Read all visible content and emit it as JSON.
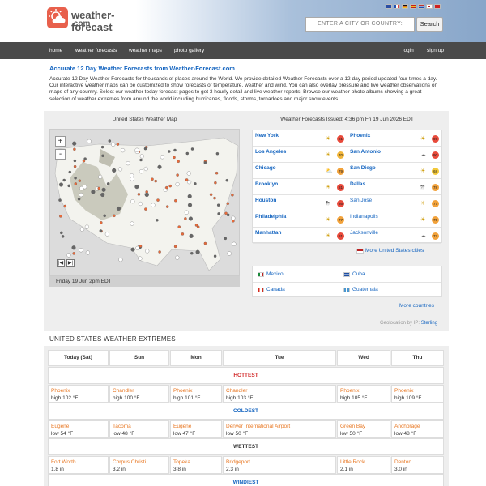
{
  "header": {
    "logo_line1": "weather-forecast",
    "logo_line2": ".com",
    "search_placeholder": "ENTER A CITY OR COUNTRY:",
    "search_button": "Search",
    "flag_colors": [
      "#2b4ea3",
      "#e04040",
      "#e8c020",
      "#c02020",
      "#d03030",
      "#2060c0"
    ]
  },
  "nav": {
    "items": [
      "home",
      "weather forecasts",
      "weather maps",
      "photo gallery"
    ],
    "login": "login",
    "signup": "sign up"
  },
  "intro": {
    "title": "Accurate 12 Day Weather Forecasts from Weather-Forecast.com",
    "text": "Accurate 12 Day Weather Forecasts for thousands of places around the World. We provide detailed Weather Forecasts over a 12 day period updated four times a day. Our interactive weather maps can be customized to show forecasts of temperature, weather and wind. You can also overlay pressure and live weather observations on maps of any country. Select our weather today forecast pages to get 3 hourly detail and live weather reports. Browse our weather photo albums showing a great selection of weather extremes from around the world including hurricanes, floods, storms, tornadoes and major snow events."
  },
  "map": {
    "title": "United States Weather Map",
    "zoom_in": "+",
    "zoom_out": "-",
    "prev": "|◀",
    "next": "▶|",
    "time_label": "Friday 19 Jun 2pm EDT"
  },
  "forecast": {
    "title": "Weather Forecasts Issued: 4:36 pm Fri 19 Jun 2026 EDT",
    "cities": [
      {
        "name": "New York",
        "icon": "☀",
        "temp": "81",
        "color": "#e84a3b",
        "bold": true
      },
      {
        "name": "Phoenix",
        "icon": "☀",
        "temp": "99",
        "color": "#e84a3b",
        "bold": true
      },
      {
        "name": "Los Angeles",
        "icon": "☀",
        "temp": "70",
        "color": "#f2b63a",
        "bold": true
      },
      {
        "name": "San Antonio",
        "icon": "☁",
        "temp": "90",
        "color": "#e84a3b",
        "bold": true
      },
      {
        "name": "Chicago",
        "icon": "⛅",
        "temp": "79",
        "color": "#f2a23a",
        "bold": true
      },
      {
        "name": "San Diego",
        "icon": "☀",
        "temp": "68",
        "color": "#f2c83a",
        "bold": true
      },
      {
        "name": "Brooklyn",
        "icon": "☀",
        "temp": "81",
        "color": "#e84a3b",
        "bold": true
      },
      {
        "name": "Dallas",
        "icon": "⛈",
        "temp": "78",
        "color": "#f2a23a",
        "bold": true
      },
      {
        "name": "Houston",
        "icon": "⛈",
        "temp": "86",
        "color": "#e84a3b",
        "bold": true
      },
      {
        "name": "San Jose",
        "icon": "☀",
        "temp": "77",
        "color": "#f2a23a",
        "bold": false
      },
      {
        "name": "Philadelphia",
        "icon": "☀",
        "temp": "77",
        "color": "#f2a23a",
        "bold": true
      },
      {
        "name": "Indianapolis",
        "icon": "☀",
        "temp": "75",
        "color": "#f2a23a",
        "bold": false
      },
      {
        "name": "Manhattan",
        "icon": "☀",
        "temp": "81",
        "color": "#e84a3b",
        "bold": true
      },
      {
        "name": "Jacksonville",
        "icon": "☁",
        "temp": "77",
        "color": "#f2a23a",
        "bold": false
      }
    ],
    "more_us": "More United States cities"
  },
  "countries": {
    "items": [
      {
        "name": "Mexico",
        "color": "#1a8a3a"
      },
      {
        "name": "Cuba",
        "color": "#1e4fa3"
      },
      {
        "name": "Canada",
        "color": "#d52b1e"
      },
      {
        "name": "Guatemala",
        "color": "#4997d0"
      }
    ],
    "more": "More countries"
  },
  "geo": {
    "label": "Geolocation by IP:",
    "city": "Sterling"
  },
  "extremes": {
    "title": "UNITED STATES WEATHER EXTREMES",
    "days": [
      "Today (Sat)",
      "Sun",
      "Mon",
      "Tue",
      "Wed",
      "Thu"
    ],
    "sections": [
      {
        "label": "HOTTEST",
        "color": "#d32f2f",
        "rows": [
          {
            "city": "Phoenix",
            "value": "high 102 °F"
          },
          {
            "city": "Chandler",
            "value": "high 100 °F"
          },
          {
            "city": "Phoenix",
            "value": "high 101 °F"
          },
          {
            "city": "Chandler",
            "value": "high 103 °F"
          },
          {
            "city": "Phoenix",
            "value": "high 105 °F"
          },
          {
            "city": "Phoenix",
            "value": "high 109 °F"
          }
        ]
      },
      {
        "label": "COLDEST",
        "color": "#1565c0",
        "rows": [
          {
            "city": "Eugene",
            "value": "low 54 °F"
          },
          {
            "city": "Tacoma",
            "value": "low 48 °F"
          },
          {
            "city": "Eugene",
            "value": "low 47 °F"
          },
          {
            "city": "Denver International Airport",
            "value": "low 50 °F"
          },
          {
            "city": "Green Bay",
            "value": "low 50 °F"
          },
          {
            "city": "Anchorage",
            "value": "low 48 °F"
          }
        ]
      },
      {
        "label": "WETTEST",
        "color": "#333333",
        "rows": [
          {
            "city": "Fort Worth",
            "value": "1.8 in"
          },
          {
            "city": "Corpus Christi",
            "value": "3.2 in"
          },
          {
            "city": "Topeka",
            "value": "3.8 in"
          },
          {
            "city": "Bridgeport",
            "value": "2.3 in"
          },
          {
            "city": "Little Rock",
            "value": "2.1 in"
          },
          {
            "city": "Denton",
            "value": "3.0 in"
          }
        ]
      },
      {
        "label": "WINDIEST",
        "color": "#1565c0",
        "rows": []
      }
    ]
  }
}
